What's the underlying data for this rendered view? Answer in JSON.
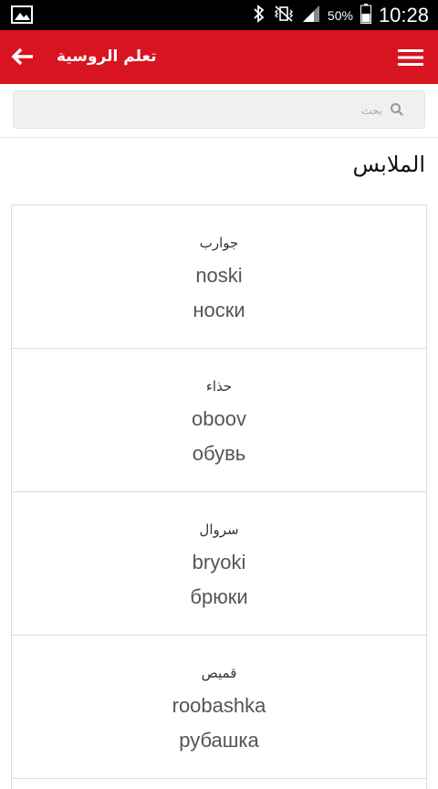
{
  "status_bar": {
    "battery_percent": "50%",
    "time": "10:28"
  },
  "app_bar": {
    "title": "تعلم الروسية",
    "back_icon": "arrow-left-icon",
    "menu_icon": "hamburger-menu-icon",
    "color": "#d7141f"
  },
  "search": {
    "placeholder": "بحث",
    "icon": "search-icon"
  },
  "section": {
    "title": "الملابس"
  },
  "items": [
    {
      "arabic": "جوارب",
      "transliteration": "noski",
      "russian": "носки"
    },
    {
      "arabic": "حذاء",
      "transliteration": "oboov",
      "russian": "обувь"
    },
    {
      "arabic": "سروال",
      "transliteration": "bryoki",
      "russian": "брюки"
    },
    {
      "arabic": "قميص",
      "transliteration": "roobashka",
      "russian": "рубашка"
    }
  ]
}
